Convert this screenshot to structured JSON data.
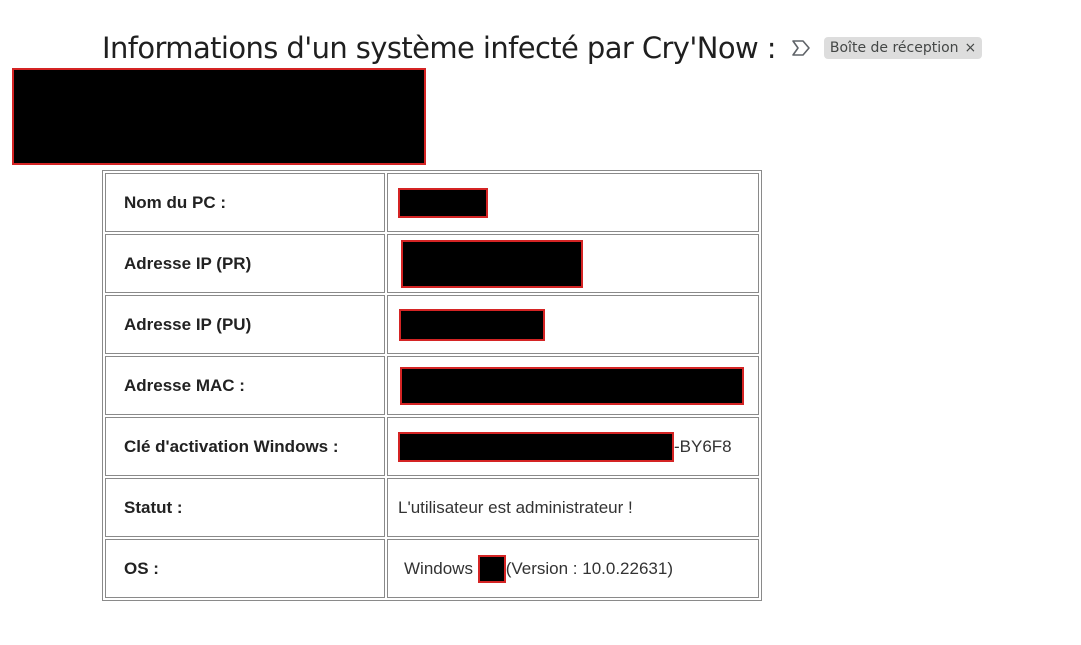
{
  "email": {
    "subject": "Informations d'un système infecté par Cry'Now :",
    "important_icon": "important-marker-icon",
    "label_chip": {
      "text": "Boîte de réception",
      "remove": "×"
    }
  },
  "table": {
    "rows": [
      {
        "label": "Nom du PC :",
        "value": ""
      },
      {
        "label": "Adresse IP (PR)",
        "value": ""
      },
      {
        "label": "Adresse IP (PU)",
        "value": ""
      },
      {
        "label": "Adresse MAC :",
        "value": ""
      },
      {
        "label": "Clé d'activation Windows :",
        "value_suffix": "-BY6F8"
      },
      {
        "label": "Statut :",
        "value": "L'utilisateur est administrateur !"
      },
      {
        "label": "OS :",
        "value_prefix": "Windows",
        "value_suffix": "(Version : 10.0.22631)"
      }
    ]
  },
  "colors": {
    "redaction_fill": "#000000",
    "redaction_border": "#d42424",
    "chip_background": "#dddddd"
  }
}
